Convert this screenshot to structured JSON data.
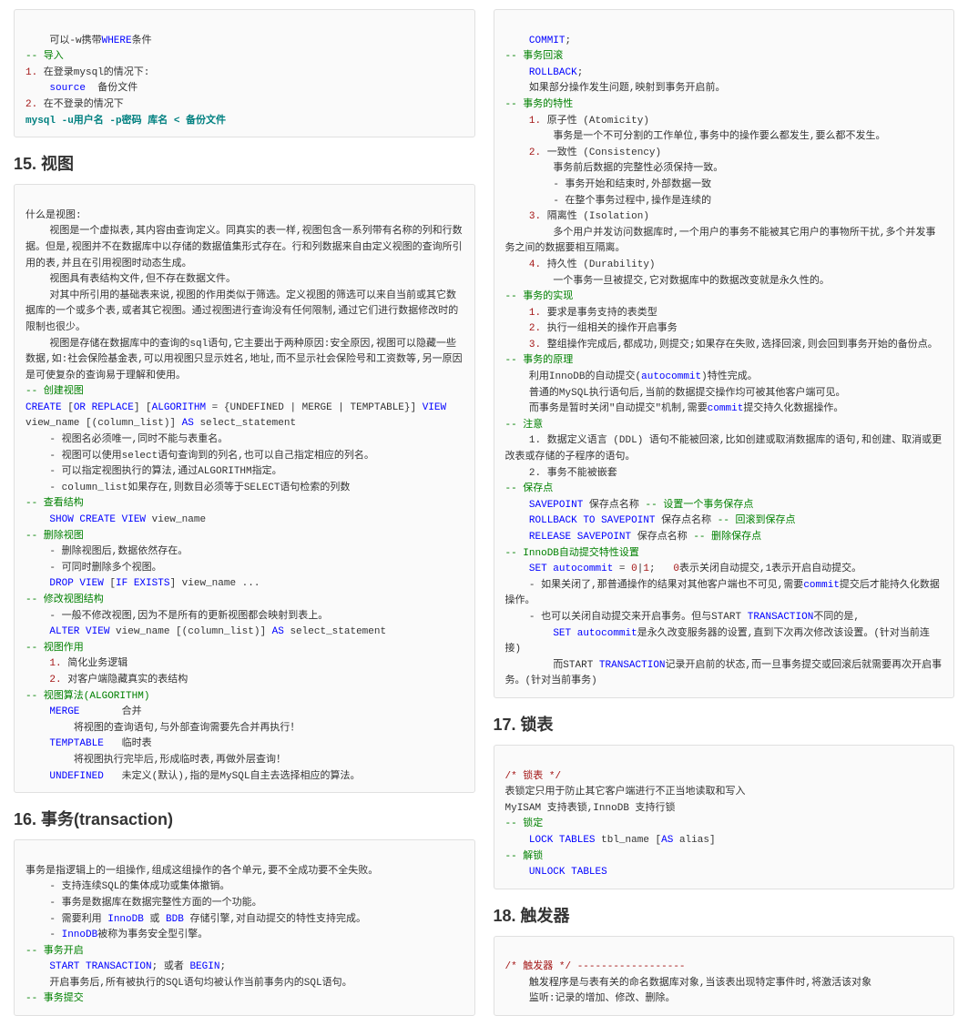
{
  "left": {
    "topbox": [
      [
        "    可以-w携带",
        "WHERE",
        "条件"
      ],
      [
        "-- 导入",
        "cm"
      ],
      [
        "1.",
        "num",
        " 在登录mysql的情况下:"
      ],
      [
        "    ",
        "source",
        "kw",
        "  备份文件"
      ],
      [
        "2.",
        "num",
        " 在不登录的情况下"
      ],
      [
        "    ",
        "mysql -u用户名 -p密码 库名 < 备份文件",
        "s"
      ]
    ],
    "h1": "15. 视图",
    "intro": "什么是视图:\n    视图是一个虚拟表,其内容由查询定义。同真实的表一样,视图包含一系列带有名称的列和行数据。但是,视图并不在数据库中以存储的数据值集形式存在。行和列数据来自由定义视图的查询所引用的表,并且在引用视图时动态生成。\n    视图具有表结构文件,但不存在数据文件。\n    对其中所引用的基础表来说,视图的作用类似于筛选。定义视图的筛选可以来自当前或其它数据库的一个或多个表,或者其它视图。通过视图进行查询没有任何限制,通过它们进行数据修改时的限制也很少。\n    视图是存储在数据库中的查询的sql语句,它主要出于两种原因:安全原因,视图可以隐藏一些数据,如:社会保险基金表,可以用视图只显示姓名,地址,而不显示社会保险号和工资数等,另一原因是可使复杂的查询易于理解和使用。",
    "b1_title": "-- 创建视图",
    "b1_code": "CREATE [OR REPLACE] [ALGORITHM = {UNDEFINED | MERGE | TEMPTABLE}] VIEW view_name [(column_list)] AS select_statement",
    "b1_notes": [
      "    - 视图名必须唯一,同时不能与表重名。",
      "    - 视图可以使用select语句查询到的列名,也可以自己指定相应的列名。",
      "    - 可以指定视图执行的算法,通过ALGORITHM指定。",
      "    - column_list如果存在,则数目必须等于SELECT语句检索的列数"
    ],
    "b2_title": "-- 查看结构",
    "b2_code": "    SHOW CREATE VIEW view_name",
    "b3_title": "-- 删除视图",
    "b3_notes": [
      "    - 删除视图后,数据依然存在。",
      "    - 可同时删除多个视图。"
    ],
    "b3_code": "    DROP VIEW [IF EXISTS] view_name ...",
    "b4_title": "-- 修改视图结构",
    "b4_notes": [
      "    - 一般不修改视图,因为不是所有的更新视图都会映射到表上。"
    ],
    "b4_code": "    ALTER VIEW view_name [(column_list)] AS select_statement",
    "b5_title": "-- 视图作用",
    "b5_items": [
      "    1. 简化业务逻辑",
      "    2. 对客户端隐藏真实的表结构"
    ],
    "b6_title": "-- 视图算法(ALGORITHM)",
    "b6_rows": [
      [
        "    MERGE",
        "       合并"
      ],
      [
        "        将视图的查询语句,与外部查询需要先合并再执行！"
      ],
      [
        "    TEMPTABLE",
        "   临时表"
      ],
      [
        "        将视图执行完毕后,形成临时表,再做外层查询！"
      ],
      [
        "    UNDEFINED",
        "   未定义(默认),指的是MySQL自主去选择相应的算法。"
      ]
    ],
    "h2": "16. 事务(transaction)",
    "tx_intro": "事务是指逻辑上的一组操作,组成这组操作的各个单元,要不全成功要不全失败。\n    - 支持连续SQL的集体成功或集体撤销。\n    - 事务是数据库在数据完整性方面的一个功能。\n    - 需要利用 InnoDB 或 BDB 存储引擎,对自动提交的特性支持完成。\n    - InnoDB被称为事务安全型引擎。",
    "tx1_title": "-- 事务开启",
    "tx1_code": "    START TRANSACTION; 或者 BEGIN;",
    "tx1_note": "    开启事务后,所有被执行的SQL语句均被认作当前事务内的SQL语句。",
    "tx2_title": "-- 事务提交"
  },
  "right": {
    "r1_code": "    COMMIT;",
    "r2_title": "-- 事务回滚",
    "r2_code": "    ROLLBACK;",
    "r2_note": "    如果部分操作发生问题,映射到事务开启前。",
    "r3_title": "-- 事务的特性",
    "r3_items": [
      [
        "1.",
        "原子性 (Atomicity)",
        "        事务是一个不可分割的工作单位,事务中的操作要么都发生,要么都不发生。"
      ],
      [
        "2.",
        "一致性 (Consistency)",
        "        事务前后数据的完整性必须保持一致。\n        - 事务开始和结束时,外部数据一致\n        - 在整个事务过程中,操作是连续的"
      ],
      [
        "3.",
        "隔离性 (Isolation)",
        "        多个用户并发访问数据库时,一个用户的事务不能被其它用户的事物所干扰,多个并发事务之间的数据要相互隔离。"
      ],
      [
        "4.",
        "持久性 (Durability)",
        "        一个事务一旦被提交,它对数据库中的数据改变就是永久性的。"
      ]
    ],
    "r4_title": "-- 事务的实现",
    "r4_items": [
      "    1. 要求是事务支持的表类型",
      "    2. 执行一组相关的操作开启事务",
      "    3. 整组操作完成后,都成功,则提交;如果存在失败,选择回滚,则会回到事务开始的备份点。"
    ],
    "r5_title": "-- 事务的原理",
    "r5_text": "    利用InnoDB的自动提交(autocommit)特性完成。\n    普通的MySQL执行语句后,当前的数据提交操作均可被其他客户端可见。\n    而事务是暂时关闭\"自动提交\"机制,需要commit提交持久化数据操作。",
    "r6_title": "-- 注意",
    "r6_items": [
      "    1. 数据定义语言 (DDL) 语句不能被回滚,比如创建或取消数据库的语句,和创建、取消或更改表或存储的子程序的语句。",
      "    2. 事务不能被嵌套"
    ],
    "r7_title": "-- 保存点",
    "r7_rows": [
      [
        "    SAVEPOINT",
        " 保存点名称 ",
        "-- 设置一个事务保存点"
      ],
      [
        "    ROLLBACK TO SAVEPOINT",
        " 保存点名称 ",
        "-- 回滚到保存点"
      ],
      [
        "    RELEASE SAVEPOINT",
        " 保存点名称 ",
        "-- 删除保存点"
      ]
    ],
    "r8_title": "-- InnoDB自动提交特性设置",
    "r8_code": "    SET autocommit = 0|1;   0表示关闭自动提交,1表示开启自动提交。",
    "r8_notes": [
      "    - 如果关闭了,那普通操作的结果对其他客户端也不可见,需要commit提交后才能持久化数据操作。",
      "    - 也可以关闭自动提交来开启事务。但与START TRANSACTION不同的是,",
      "        SET autocommit是永久改变服务器的设置,直到下次再次修改该设置。(针对当前连接)",
      "        而START TRANSACTION记录开启前的状态,而一旦事务提交或回滚后就需要再次开启事务。(针对当前事务)"
    ],
    "h3": "17. 锁表",
    "lock_head": "/* 锁表 */",
    "lock_text": "表锁定只用于防止其它客户端进行不正当地读取和写入\nMyISAM 支持表锁,InnoDB 支持行锁",
    "lock1_title": "-- 锁定",
    "lock1_code": "    LOCK TABLES tbl_name [AS alias]",
    "lock2_title": "-- 解锁",
    "lock2_code": "    UNLOCK TABLES",
    "h4": "18. 触发器",
    "trig_head": "/* 触发器 */ ------------------",
    "trig_text": "    触发程序是与表有关的命名数据库对象,当该表出现特定事件时,将激活该对象\n    监听:记录的增加、修改、删除。"
  }
}
